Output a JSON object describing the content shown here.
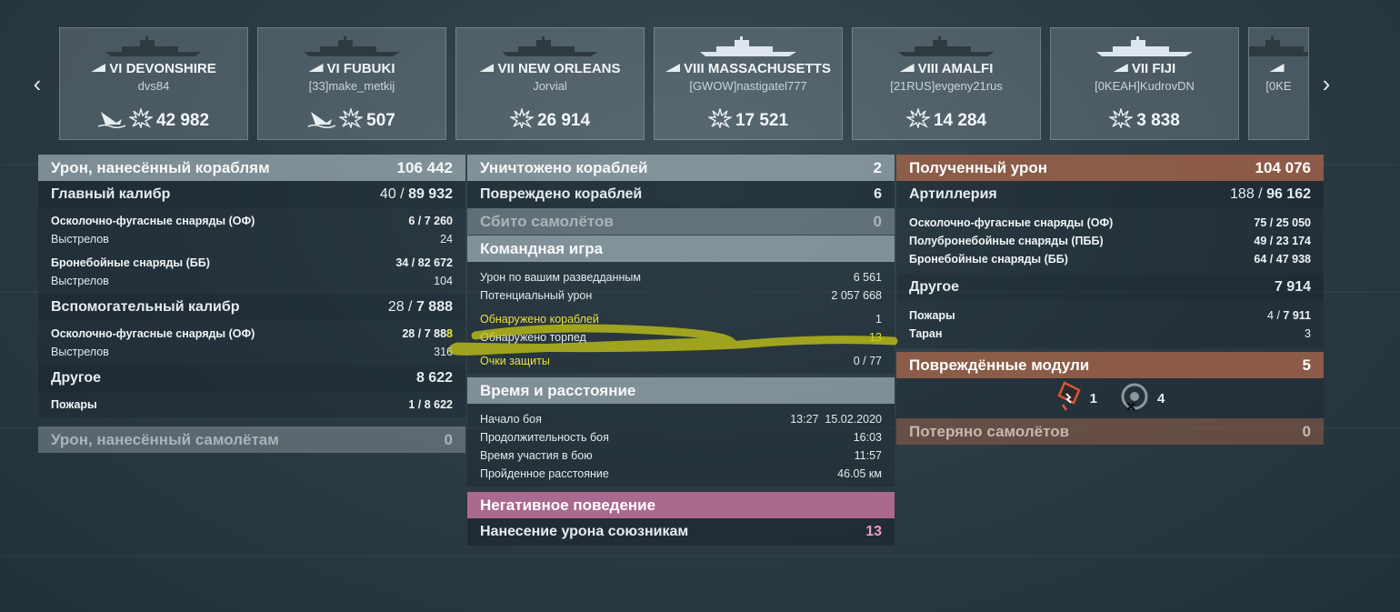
{
  "ships": [
    {
      "tier_name": "VI DEVONSHIRE",
      "player": "dvs84",
      "damage": "42 982",
      "sunk_icon": true
    },
    {
      "tier_name": "VI FUBUKI",
      "player": "[33]make_metkij",
      "damage": "507",
      "sunk_icon": true
    },
    {
      "tier_name": "VII NEW ORLEANS",
      "player": "Jorvial",
      "damage": "26 914",
      "sunk_icon": false
    },
    {
      "tier_name": "VIII MASSACHUSETTS",
      "player": "[GWOW]nastigatel777",
      "damage": "17 521",
      "sunk_icon": false
    },
    {
      "tier_name": "VIII AMALFI",
      "player": "[21RUS]evgeny21rus",
      "damage": "14 284",
      "sunk_icon": false
    },
    {
      "tier_name": "VII FIJI",
      "player": "[0KEAH]KudrovDN",
      "damage": "3 838",
      "sunk_icon": false
    },
    {
      "tier_name": "",
      "player": "[0KE",
      "damage": "",
      "sunk_icon": false
    }
  ],
  "nav": {
    "prev": "‹",
    "next": "›"
  },
  "left": {
    "header": {
      "label": "Урон, нанесённый кораблям",
      "value": "106 442"
    },
    "main_caliber": {
      "label": "Главный калибр",
      "hits": "40 /",
      "dmg": "89 932"
    },
    "he": {
      "label": "Осколочно-фугасные снаряды (ОФ)",
      "hits": "6 /",
      "dmg": "7 260"
    },
    "he_shots": {
      "label": "Выстрелов",
      "value": "24"
    },
    "ap": {
      "label": "Бронебойные снаряды (ББ)",
      "hits": "34 /",
      "dmg": "82 672"
    },
    "ap_shots": {
      "label": "Выстрелов",
      "value": "104"
    },
    "secondary": {
      "label": "Вспомогательный калибр",
      "hits": "28 /",
      "dmg": "7 888"
    },
    "sec_he": {
      "label": "Осколочно-фугасные снаряды (ОФ)",
      "hits": "28 /",
      "dmg": "7 88",
      "dmg_last": "8"
    },
    "sec_shots": {
      "label": "Выстрелов",
      "value": "316"
    },
    "other": {
      "label": "Другое",
      "value": "8 622"
    },
    "fires": {
      "label": "Пожары",
      "hits": "1 /",
      "dmg": "8 622"
    },
    "planes": {
      "label": "Урон, нанесённый самолётам",
      "value": "0"
    }
  },
  "middle": {
    "destroyed": {
      "label": "Уничтожено кораблей",
      "value": "2"
    },
    "damaged": {
      "label": "Повреждено кораблей",
      "value": "6"
    },
    "planes_shot": {
      "label": "Сбито самолётов",
      "value": "0"
    },
    "team_header": "Командная игра",
    "spot_dmg": {
      "label": "Урон по вашим разведданным",
      "value": "6 561"
    },
    "potential": {
      "label": "Потенциальный урон",
      "value": "2 057 668"
    },
    "ships_spotted": {
      "label": "Обнаружено кораблей",
      "value": "1"
    },
    "torps_spotted": {
      "label": "Обнаружено торпед",
      "value": "13"
    },
    "defense": {
      "label": "Очки защиты",
      "value": "0 / 77"
    },
    "time_header": "Время и расстояние",
    "start": {
      "label": "Начало боя",
      "value": "13:27  15.02.2020"
    },
    "duration": {
      "label": "Продолжительность боя",
      "value": "16:03"
    },
    "participation": {
      "label": "Время участия в бою",
      "value": "11:57"
    },
    "distance": {
      "label": "Пройденное расстояние",
      "value": "46.05 км"
    },
    "negative_header": "Негативное поведение",
    "team_damage": {
      "label": "Нанесение урона союзникам",
      "value": "13"
    }
  },
  "right": {
    "header": {
      "label": "Полученный урон",
      "value": "104 076"
    },
    "artillery": {
      "label": "Артиллерия",
      "hits": "188 /",
      "dmg": "96 162"
    },
    "he": {
      "label": "Осколочно-фугасные снаряды (ОФ)",
      "hits": "75 /",
      "dmg": "25 050"
    },
    "sap": {
      "label": "Полубронебойные снаряды (ПББ)",
      "hits": "49 /",
      "dmg": "23 174"
    },
    "ap": {
      "label": "Бронебойные снаряды (ББ)",
      "hits": "64 /",
      "dmg": "47 938"
    },
    "other": {
      "label": "Другое",
      "value": "7 914"
    },
    "fires": {
      "label": "Пожары",
      "hits": "4 /",
      "dmg": "7 911"
    },
    "ram": {
      "label": "Таран",
      "value": "3"
    },
    "modules": {
      "label": "Повреждённые модули",
      "value": "5"
    },
    "module_a": "1",
    "module_b": "4",
    "planes_lost": {
      "label": "Потеряно самолётов",
      "value": "0"
    }
  }
}
